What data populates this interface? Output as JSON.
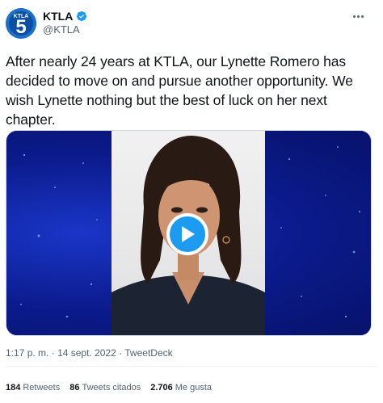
{
  "account": {
    "name": "KTLA",
    "handle": "@KTLA",
    "avatar_text": "KTLA",
    "avatar_number": "5"
  },
  "tweet": {
    "text": "After nearly 24 years at KTLA, our Lynette Romero has decided to move on and pursue another opportunity. We wish Lynette nothing but the best of luck on her next chapter."
  },
  "meta": {
    "time": "1:17 p. m.",
    "date": "14 sept. 2022",
    "source": "TweetDeck",
    "separator": "·"
  },
  "stats": {
    "retweets_count": "184",
    "retweets_label": "Retweets",
    "quotes_count": "86",
    "quotes_label": "Tweets citados",
    "likes_count": "2.706",
    "likes_label": "Me gusta"
  },
  "icons": {
    "verified": "verified-badge-icon",
    "more": "more-options-icon",
    "play": "play-icon"
  },
  "colors": {
    "accent": "#1d9bf0",
    "media_background": "#0d1f8e",
    "avatar": "#1d70c9"
  }
}
